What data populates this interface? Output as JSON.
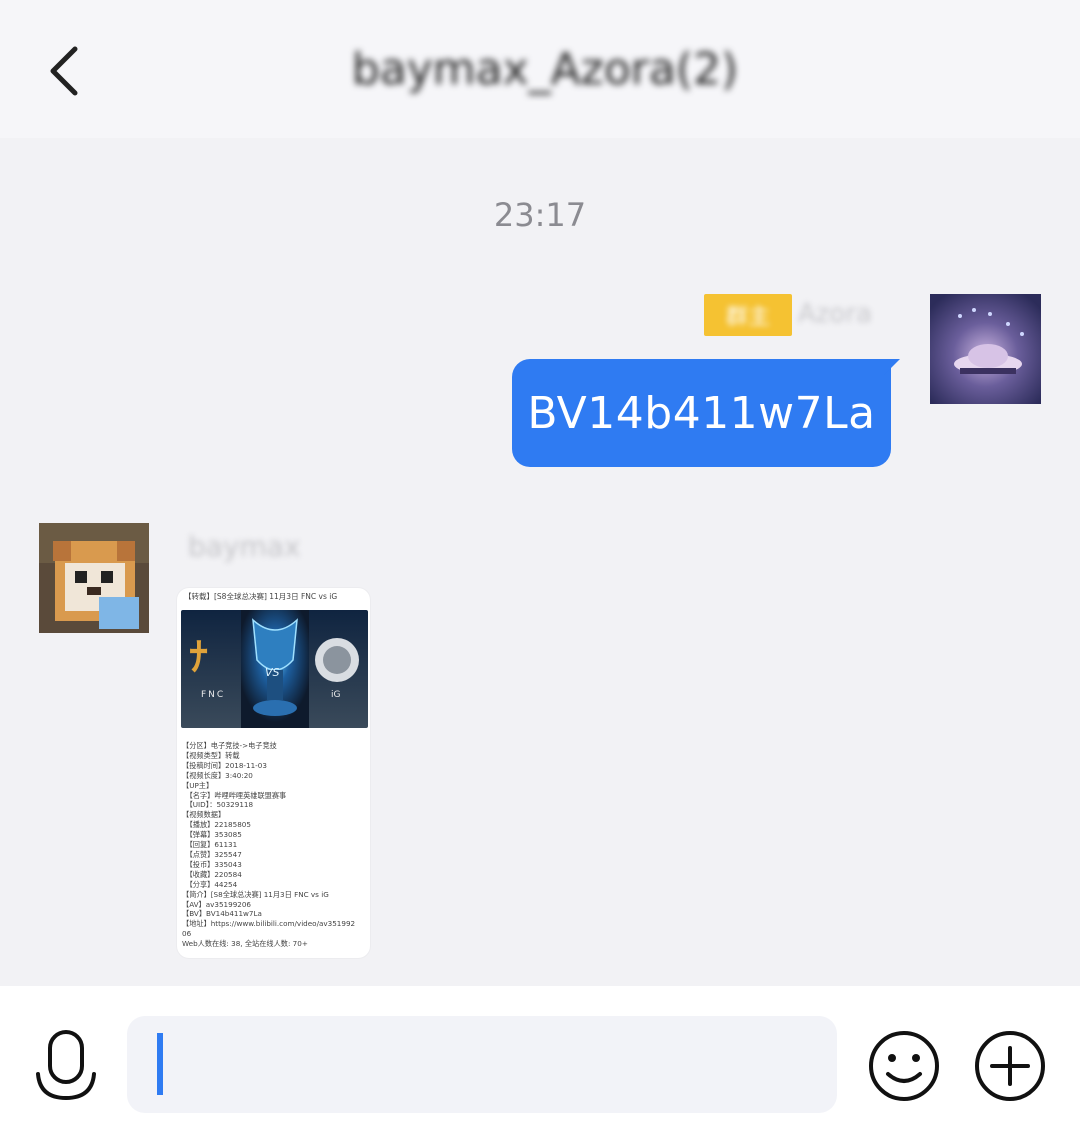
{
  "header": {
    "back_icon": "chevron-left-icon",
    "title": "baymax_Azora(2)"
  },
  "chat": {
    "timestamp": "23:17",
    "messages": [
      {
        "direction": "outgoing",
        "sender_badge": "群主",
        "sender_name": "Azora",
        "text": "BV14b411w7La",
        "bubble_color": "#2f7bf2"
      },
      {
        "direction": "incoming",
        "sender_name": "baymax",
        "card": {
          "title": "【转载】[S8全球总决赛] 11月3日 FNC vs iG",
          "image_labels": {
            "left_team": "FNC",
            "vs": "VS",
            "right_team": "iG"
          },
          "info_lines": [
            "【分区】电子竞技->电子竞技",
            "【视频类型】转载",
            "【投稿时间】2018-11-03",
            "【视频长度】3:40:20",
            "【UP主】",
            "　【名字】哔哩哔哩英雄联盟赛事",
            "　【UID】：50329118",
            "【视频数据】",
            "　【播放】22185805",
            "　【弹幕】353085",
            "　【回复】61131",
            "　【点赞】325547",
            "　【投币】335043",
            "　【收藏】220584",
            "　【分享】44254",
            "【简介】[S8全球总决赛] 11月3日 FNC vs iG",
            "【AV】av35199206",
            "【BV】BV14b411w7La",
            "【地址】https://www.bilibili.com/video/av351992",
            "06",
            "Web人数在线: 38, 全站在线人数: 70+"
          ]
        }
      }
    ]
  },
  "composer": {
    "mic_icon": "microphone-icon",
    "input_value": "",
    "emoji_icon": "smiley-icon",
    "plus_icon": "plus-circle-icon"
  },
  "colors": {
    "accent": "#2f7bf2",
    "badge": "#f5c232",
    "background": "#f2f2f5"
  }
}
